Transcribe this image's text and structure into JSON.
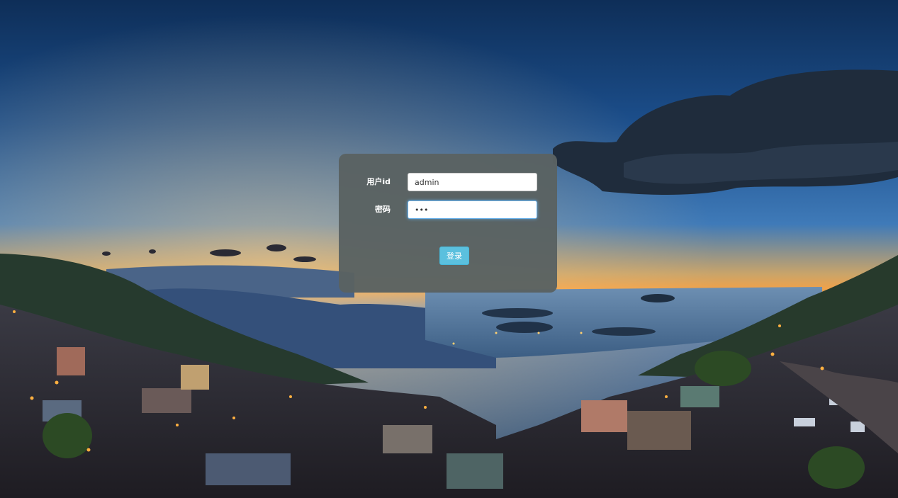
{
  "login": {
    "userid_label": "用户id",
    "userid_value": "admin",
    "password_label": "密码",
    "password_value": "abc",
    "submit_label": "登录"
  },
  "colors": {
    "panel": "#5a6262",
    "button": "#5bc0de",
    "focus_ring": "#66afe9"
  }
}
